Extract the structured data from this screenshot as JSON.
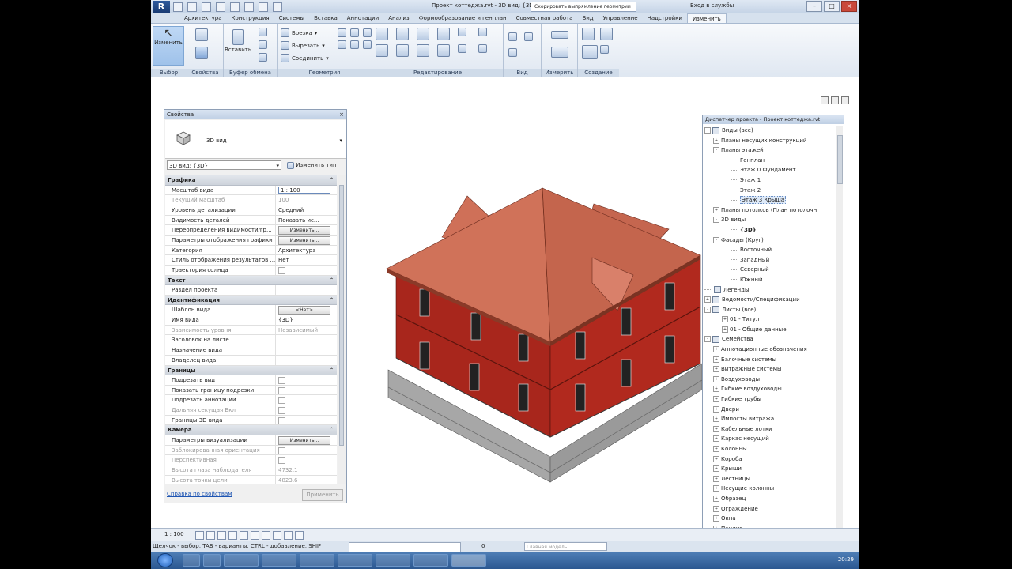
{
  "app": {
    "logo": "R",
    "title": "Проект коттеджа.rvt - 3D вид: {3D}",
    "search_placeholder": "Скорировать выпрямление геометрии",
    "login": "Вход в службы"
  },
  "ribbon_tabs": [
    "Архитектура",
    "Конструкция",
    "Системы",
    "Вставка",
    "Аннотации",
    "Анализ",
    "Формообразование и генплан",
    "Совместная работа",
    "Вид",
    "Управление",
    "Надстройки",
    "Изменить"
  ],
  "ribbon_panels": {
    "modify_label": "Изменить",
    "select": "Выбор",
    "properties": "Свойства",
    "clipboard": "Буфер обмена",
    "paste": "Вставить",
    "geometry": "Геометрия",
    "cope": "Врезка",
    "cut": "Вырезать",
    "join": "Соединить",
    "modify_panel": "Редактирование",
    "view": "Вид",
    "measure": "Измерить",
    "create": "Создание"
  },
  "properties": {
    "title": "Свойства",
    "close": "×",
    "type_name": "3D вид",
    "instance_selector": "3D вид: {3D}",
    "edit_type": "Изменить тип",
    "groups": [
      {
        "name": "Графика",
        "rows": [
          {
            "k": "Масштаб вида",
            "v": "1 : 100",
            "kind": "input"
          },
          {
            "k": "Текущий масштаб",
            "v": "100",
            "kind": "dis"
          },
          {
            "k": "Уровень детализации",
            "v": "Средний"
          },
          {
            "k": "Видимость деталей",
            "v": "Показать ис..."
          },
          {
            "k": "Переопределения видимости/гр...",
            "v": "Изменить...",
            "kind": "btn"
          },
          {
            "k": "Параметры отображения графики",
            "v": "Изменить...",
            "kind": "btn"
          },
          {
            "k": "Категория",
            "v": "Архитектура"
          },
          {
            "k": "Стиль отображения результатов ...",
            "v": "Нет"
          },
          {
            "k": "Траектория солнца",
            "v": "",
            "kind": "cb"
          }
        ]
      },
      {
        "name": "Текст",
        "rows": [
          {
            "k": "Раздел проекта",
            "v": ""
          }
        ]
      },
      {
        "name": "Идентификация",
        "rows": [
          {
            "k": "Шаблон вида",
            "v": "<Нет>",
            "kind": "btn"
          },
          {
            "k": "Имя вида",
            "v": "{3D}"
          },
          {
            "k": "Зависимость уровня",
            "v": "Независимый",
            "kind": "dis"
          },
          {
            "k": "Заголовок на листе",
            "v": ""
          },
          {
            "k": "Назначение вида",
            "v": ""
          },
          {
            "k": "Владелец вида",
            "v": ""
          }
        ]
      },
      {
        "name": "Границы",
        "rows": [
          {
            "k": "Подрезать вид",
            "v": "",
            "kind": "cb"
          },
          {
            "k": "Показать границу подрезки",
            "v": "",
            "kind": "cb"
          },
          {
            "k": "Подрезать аннотации",
            "v": "",
            "kind": "cb"
          },
          {
            "k": "Дальняя секущая Вкл",
            "v": "",
            "kind": "cbdis"
          },
          {
            "k": "Границы 3D вида",
            "v": "",
            "kind": "cb"
          }
        ]
      },
      {
        "name": "Камера",
        "rows": [
          {
            "k": "Параметры визуализации",
            "v": "Изменить...",
            "kind": "btn"
          },
          {
            "k": "Заблокированная ориентация",
            "v": "",
            "kind": "cbdis"
          },
          {
            "k": "Перспективная",
            "v": "",
            "kind": "cbdis"
          },
          {
            "k": "Высота глаза наблюдателя",
            "v": "4732.1",
            "kind": "dis"
          },
          {
            "k": "Высота точки цели",
            "v": "4823.6",
            "kind": "dis"
          }
        ]
      }
    ],
    "help_link": "Справка по свойствам",
    "apply": "Применить"
  },
  "browser": {
    "title": "Диспетчер проекта - Проект коттеджа.rvt",
    "items": [
      {
        "l": "Виды (все)",
        "d": 0,
        "pm": "-",
        "ic": true
      },
      {
        "l": "Планы несущих конструкций",
        "d": 1,
        "pm": "+"
      },
      {
        "l": "Планы этажей",
        "d": 1,
        "pm": "-"
      },
      {
        "l": "Генплан",
        "d": 3
      },
      {
        "l": "Этаж 0 Фундамент",
        "d": 3
      },
      {
        "l": "Этаж 1",
        "d": 3
      },
      {
        "l": "Этаж 2",
        "d": 3
      },
      {
        "l": "Этаж 3 Крыша",
        "d": 3,
        "sel": true
      },
      {
        "l": "Планы потолков (План потолочн",
        "d": 1,
        "pm": "+"
      },
      {
        "l": "3D виды",
        "d": 1,
        "pm": "-"
      },
      {
        "l": "{3D}",
        "d": 3,
        "bold": true
      },
      {
        "l": "Фасады (Круг)",
        "d": 1,
        "pm": "-"
      },
      {
        "l": "Восточный",
        "d": 3
      },
      {
        "l": "Западный",
        "d": 3
      },
      {
        "l": "Северный",
        "d": 3
      },
      {
        "l": "Южный",
        "d": 3
      },
      {
        "l": "Легенды",
        "d": 0,
        "ic": true
      },
      {
        "l": "Ведомости/Спецификации",
        "d": 0,
        "pm": "+",
        "ic": true
      },
      {
        "l": "Листы (все)",
        "d": 0,
        "pm": "-",
        "ic": true
      },
      {
        "l": "01 - Титул",
        "d": 2,
        "pm": "+"
      },
      {
        "l": "01 - Общие данные",
        "d": 2,
        "pm": "+"
      },
      {
        "l": "Семейства",
        "d": 0,
        "pm": "-",
        "ic": true
      },
      {
        "l": "Аннотационные обозначения",
        "d": 1,
        "pm": "+"
      },
      {
        "l": "Балочные системы",
        "d": 1,
        "pm": "+"
      },
      {
        "l": "Витражные системы",
        "d": 1,
        "pm": "+"
      },
      {
        "l": "Воздуховоды",
        "d": 1,
        "pm": "+"
      },
      {
        "l": "Гибкие воздуховоды",
        "d": 1,
        "pm": "+"
      },
      {
        "l": "Гибкие трубы",
        "d": 1,
        "pm": "+"
      },
      {
        "l": "Двери",
        "d": 1,
        "pm": "+"
      },
      {
        "l": "Импосты витража",
        "d": 1,
        "pm": "+"
      },
      {
        "l": "Кабельные лотки",
        "d": 1,
        "pm": "+"
      },
      {
        "l": "Каркас несущий",
        "d": 1,
        "pm": "+"
      },
      {
        "l": "Колонны",
        "d": 1,
        "pm": "+"
      },
      {
        "l": "Короба",
        "d": 1,
        "pm": "+"
      },
      {
        "l": "Крыши",
        "d": 1,
        "pm": "+"
      },
      {
        "l": "Лестницы",
        "d": 1,
        "pm": "+"
      },
      {
        "l": "Несущие колонны",
        "d": 1,
        "pm": "+"
      },
      {
        "l": "Образец",
        "d": 1,
        "pm": "+"
      },
      {
        "l": "Ограждение",
        "d": 1,
        "pm": "+"
      },
      {
        "l": "Окна",
        "d": 1,
        "pm": "+"
      },
      {
        "l": "Пандус",
        "d": 1,
        "pm": "+"
      }
    ]
  },
  "view_bar": {
    "scale": "1 : 100"
  },
  "status": {
    "text": "Щелчок - выбор, TAB - варианты, CTRL - добавление, SHIF",
    "model": "Главная модель",
    "zero": "0"
  },
  "taskbar": {
    "clock": "20:29"
  },
  "colors": {
    "roof": "#c8664e",
    "brick": "#a8261c",
    "base": "#9c9c9c"
  }
}
